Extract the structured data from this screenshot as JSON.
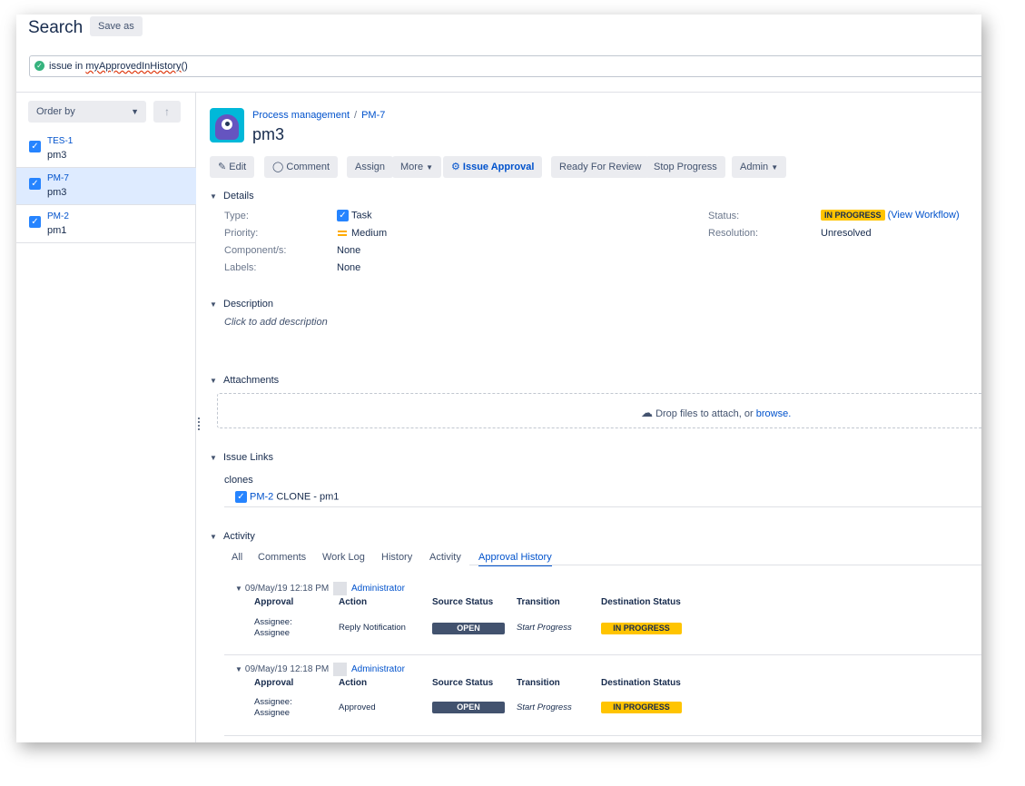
{
  "header": {
    "title": "Search",
    "save_as": "Save as"
  },
  "jql": {
    "prefix": "issue in ",
    "function": "myApprovedInHistory",
    "suffix": "()"
  },
  "sidebar": {
    "order_by": "Order by",
    "issues": [
      {
        "key": "TES-1",
        "summary": "pm3"
      },
      {
        "key": "PM-7",
        "summary": "pm3"
      },
      {
        "key": "PM-2",
        "summary": "pm1"
      }
    ]
  },
  "issue": {
    "project": "Process management",
    "key": "PM-7",
    "title": "pm3"
  },
  "toolbar": {
    "edit": "Edit",
    "comment": "Comment",
    "assign": "Assign",
    "more": "More",
    "issue_approval": "Issue Approval",
    "ready_for_review": "Ready For Review",
    "stop_progress": "Stop Progress",
    "admin": "Admin"
  },
  "details": {
    "heading": "Details",
    "type_label": "Type:",
    "type_value": "Task",
    "priority_label": "Priority:",
    "priority_value": "Medium",
    "components_label": "Component/s:",
    "components_value": "None",
    "labels_label": "Labels:",
    "labels_value": "None",
    "status_label": "Status:",
    "status_value": "IN PROGRESS",
    "view_workflow": "(View Workflow)",
    "resolution_label": "Resolution:",
    "resolution_value": "Unresolved"
  },
  "description": {
    "heading": "Description",
    "placeholder": "Click to add description"
  },
  "attachments": {
    "heading": "Attachments",
    "drop_text": "Drop files to attach, or ",
    "browse": "browse."
  },
  "issue_links": {
    "heading": "Issue Links",
    "relation": "clones",
    "linked_key": "PM-2",
    "linked_summary": "CLONE - pm1"
  },
  "activity": {
    "heading": "Activity",
    "tabs": [
      "All",
      "Comments",
      "Work Log",
      "History",
      "Activity",
      "Approval History"
    ],
    "columns": {
      "approval": "Approval",
      "action": "Action",
      "source": "Source Status",
      "transition": "Transition",
      "destination": "Destination Status"
    },
    "entries": [
      {
        "time": "09/May/19 12:18 PM",
        "user": "Administrator",
        "approval_1": "Assignee:",
        "approval_2": "Assignee",
        "action": "Reply Notification",
        "source": "OPEN",
        "transition": "Start Progress",
        "destination": "IN PROGRESS"
      },
      {
        "time": "09/May/19 12:18 PM",
        "user": "Administrator",
        "approval_1": "Assignee:",
        "approval_2": "Assignee",
        "action": "Approved",
        "source": "OPEN",
        "transition": "Start Progress",
        "destination": "IN PROGRESS"
      }
    ]
  }
}
